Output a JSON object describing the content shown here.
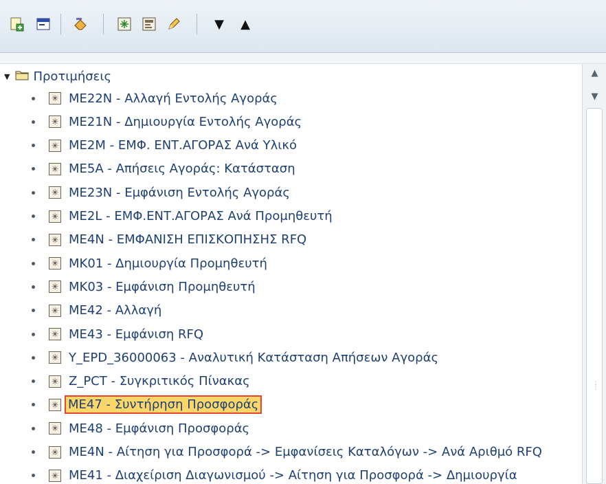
{
  "toolbar": {
    "buttons": [
      {
        "name": "add-favorite-icon"
      },
      {
        "name": "insert-folder-icon"
      },
      {
        "name": "delete-eraser-icon"
      },
      {
        "name": "add-transaction-icon"
      },
      {
        "name": "add-other-object-icon"
      },
      {
        "name": "change-pencil-icon"
      },
      {
        "name": "move-down-icon",
        "glyph": "▼"
      },
      {
        "name": "move-up-icon",
        "glyph": "▲"
      }
    ]
  },
  "tree": {
    "root_label": "Προτιμήσεις",
    "items": [
      {
        "label": "ME22N - Αλλαγή Εντολής Αγοράς"
      },
      {
        "label": "ME21N - Δημιουργία Εντολής Αγοράς"
      },
      {
        "label": "ME2M - ΕΜΦ. ΕΝΤ.ΑΓΟΡΑΣ Ανά Υλικό"
      },
      {
        "label": "ME5A - Απήσεις Αγοράς: Κατάσταση"
      },
      {
        "label": "ME23N - Εμφάνιση Εντολής Αγοράς"
      },
      {
        "label": "ME2L - ΕΜΦ.ΕΝΤ.ΑΓΟΡΑΣ Ανά Προμηθευτή"
      },
      {
        "label": "ME4N - ΕΜΦΑΝΙΣΗ ΕΠΙΣΚΟΠΗΣΗΣ RFQ"
      },
      {
        "label": "MK01 - Δημιουργία Προμηθευτή"
      },
      {
        "label": "MK03 - Εμφάνιση Προμηθευτή"
      },
      {
        "label": "ME42 - Αλλαγή"
      },
      {
        "label": "ME43 - Εμφάνιση RFQ"
      },
      {
        "label": "Y_EPD_36000063 - Αναλυτική Κατάσταση Απήσεων Αγοράς"
      },
      {
        "label": "Z_PCT - Συγκριτικός Πίνακας"
      },
      {
        "label": "ME47 - Συντήρηση Προσφοράς",
        "selected": true
      },
      {
        "label": "ME48 - Εμφάνιση Προσφοράς"
      },
      {
        "label": "ME4N - Αίτηση για Προσφορά -> Εμφανίσεις Καταλόγων -> Ανά Αριθμό RFQ"
      },
      {
        "label": "ME41 - Διαχείριση Διαγωνισμού -> Αίτηση για Προσφορά -> Δημιουργία"
      }
    ]
  },
  "colors": {
    "label_text": "#1d3f72",
    "selection_fill": "#fbd66a",
    "selection_border": "#e2462c"
  }
}
